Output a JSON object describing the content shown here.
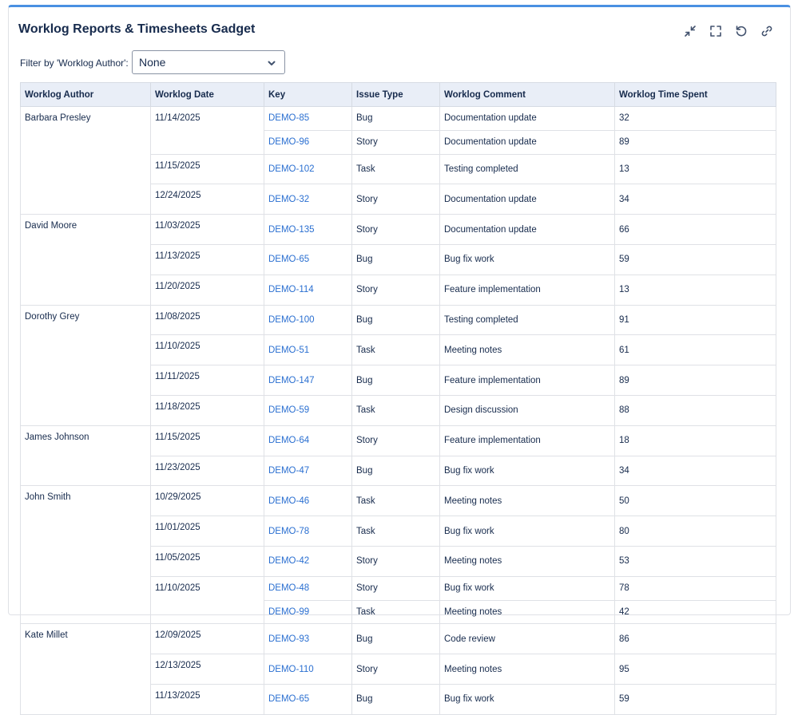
{
  "gadget": {
    "title": "Worklog Reports & Timesheets Gadget",
    "icons": [
      "collapse-icon",
      "fullscreen-icon",
      "refresh-icon",
      "link-icon"
    ]
  },
  "filter": {
    "label": "Filter by 'Worklog Author':",
    "selected": "None"
  },
  "table": {
    "headers": [
      "Worklog Author",
      "Worklog Date",
      "Key",
      "Issue Type",
      "Worklog Comment",
      "Worklog Time Spent"
    ],
    "groups": [
      {
        "author": "Barbara Presley",
        "dates": [
          {
            "date": "11/14/2025",
            "entries": [
              {
                "key": "DEMO-85",
                "type": "Bug",
                "comment": "Documentation update",
                "time": "32"
              },
              {
                "key": "DEMO-96",
                "type": "Story",
                "comment": "Documentation update",
                "time": "89"
              }
            ]
          },
          {
            "date": "11/15/2025",
            "entries": [
              {
                "key": "DEMO-102",
                "type": "Task",
                "comment": "Testing completed",
                "time": "13"
              }
            ]
          },
          {
            "date": "12/24/2025",
            "entries": [
              {
                "key": "DEMO-32",
                "type": "Story",
                "comment": "Documentation update",
                "time": "34"
              }
            ]
          }
        ]
      },
      {
        "author": "David Moore",
        "dates": [
          {
            "date": "11/03/2025",
            "entries": [
              {
                "key": "DEMO-135",
                "type": "Story",
                "comment": "Documentation update",
                "time": "66"
              }
            ]
          },
          {
            "date": "11/13/2025",
            "entries": [
              {
                "key": "DEMO-65",
                "type": "Bug",
                "comment": "Bug fix work",
                "time": "59"
              }
            ]
          },
          {
            "date": "11/20/2025",
            "entries": [
              {
                "key": "DEMO-114",
                "type": "Story",
                "comment": "Feature implementation",
                "time": "13"
              }
            ]
          }
        ]
      },
      {
        "author": "Dorothy Grey",
        "dates": [
          {
            "date": "11/08/2025",
            "entries": [
              {
                "key": "DEMO-100",
                "type": "Bug",
                "comment": "Testing completed",
                "time": "91"
              }
            ]
          },
          {
            "date": "11/10/2025",
            "entries": [
              {
                "key": "DEMO-51",
                "type": "Task",
                "comment": "Meeting notes",
                "time": "61"
              }
            ]
          },
          {
            "date": "11/11/2025",
            "entries": [
              {
                "key": "DEMO-147",
                "type": "Bug",
                "comment": "Feature implementation",
                "time": "89"
              }
            ]
          },
          {
            "date": "11/18/2025",
            "entries": [
              {
                "key": "DEMO-59",
                "type": "Task",
                "comment": "Design discussion",
                "time": "88"
              }
            ]
          }
        ]
      },
      {
        "author": "James Johnson",
        "dates": [
          {
            "date": "11/15/2025",
            "entries": [
              {
                "key": "DEMO-64",
                "type": "Story",
                "comment": "Feature implementation",
                "time": "18"
              }
            ]
          },
          {
            "date": "11/23/2025",
            "entries": [
              {
                "key": "DEMO-47",
                "type": "Bug",
                "comment": "Bug fix work",
                "time": "34"
              }
            ]
          }
        ]
      },
      {
        "author": "John Smith",
        "dates": [
          {
            "date": "10/29/2025",
            "entries": [
              {
                "key": "DEMO-46",
                "type": "Task",
                "comment": "Meeting notes",
                "time": "50"
              }
            ]
          },
          {
            "date": "11/01/2025",
            "entries": [
              {
                "key": "DEMO-78",
                "type": "Task",
                "comment": "Bug fix work",
                "time": "80"
              }
            ]
          },
          {
            "date": "11/05/2025",
            "entries": [
              {
                "key": "DEMO-42",
                "type": "Story",
                "comment": "Meeting notes",
                "time": "53"
              }
            ]
          },
          {
            "date": "11/10/2025",
            "entries": [
              {
                "key": "DEMO-48",
                "type": "Story",
                "comment": "Bug fix work",
                "time": "78"
              },
              {
                "key": "DEMO-99",
                "type": "Task",
                "comment": "Meeting notes",
                "time": "42"
              }
            ]
          }
        ]
      },
      {
        "author": "Kate Millet",
        "dates": [
          {
            "date": "12/09/2025",
            "entries": [
              {
                "key": "DEMO-93",
                "type": "Bug",
                "comment": "Code review",
                "time": "86"
              }
            ]
          },
          {
            "date": "12/13/2025",
            "entries": [
              {
                "key": "DEMO-110",
                "type": "Story",
                "comment": "Meeting notes",
                "time": "95"
              }
            ]
          },
          {
            "date": "11/13/2025",
            "entries": [
              {
                "key": "DEMO-65",
                "type": "Bug",
                "comment": "Bug fix work",
                "time": "59"
              }
            ]
          }
        ]
      }
    ]
  }
}
